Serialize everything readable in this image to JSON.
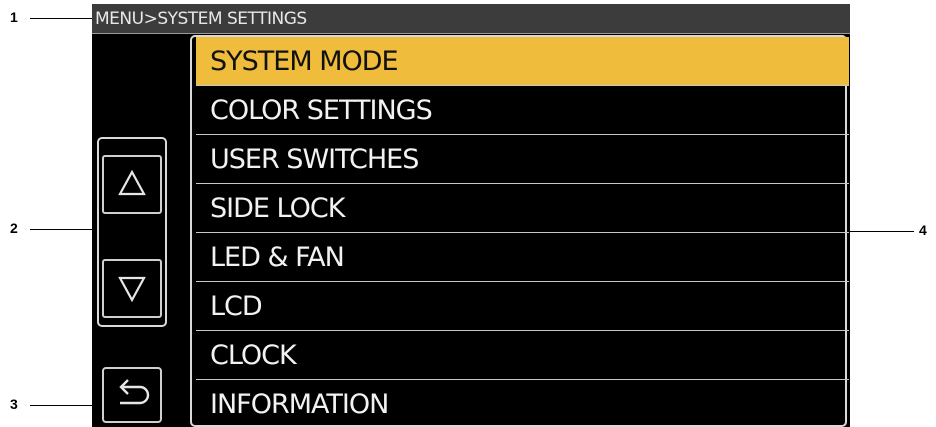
{
  "breadcrumb": "MENU>SYSTEM SETTINGS",
  "menu": {
    "items": [
      {
        "label": "SYSTEM MODE",
        "selected": true
      },
      {
        "label": "COLOR SETTINGS",
        "selected": false
      },
      {
        "label": "USER SWITCHES",
        "selected": false
      },
      {
        "label": "SIDE LOCK",
        "selected": false
      },
      {
        "label": "LED & FAN",
        "selected": false
      },
      {
        "label": "LCD",
        "selected": false
      },
      {
        "label": "CLOCK",
        "selected": false
      },
      {
        "label": "INFORMATION",
        "selected": false
      }
    ]
  },
  "buttons": {
    "scroll_up_icon": "triangle-up-icon",
    "scroll_down_icon": "triangle-down-icon",
    "back_icon": "return-arrow-icon"
  },
  "callouts": [
    "1",
    "2",
    "3",
    "4"
  ],
  "colors": {
    "selected_bg": "#efbc3c",
    "screen_bg": "#000000",
    "breadcrumb_bg": "#3c3c3c"
  }
}
